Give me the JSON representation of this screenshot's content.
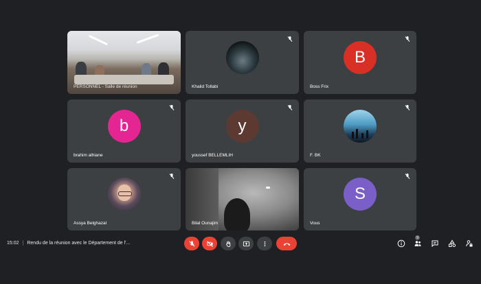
{
  "participants": [
    {
      "name": "PERSONNEL - Salle de réunion",
      "type": "room-video"
    },
    {
      "name": "Khalid Tollabi",
      "type": "photo-night"
    },
    {
      "name": "Boss Frix",
      "type": "avatar",
      "initial": "B",
      "color": "#d93025"
    },
    {
      "name": "brahim alhiane",
      "type": "avatar",
      "initial": "b",
      "color": "#e52592"
    },
    {
      "name": "youssef BELLEMLIH",
      "type": "avatar",
      "initial": "y",
      "color": "#5c3a31"
    },
    {
      "name": "F. BK",
      "type": "photo-sky"
    },
    {
      "name": "Assya Belghazal",
      "type": "photo-hijab"
    },
    {
      "name": "Bilal Ounajim",
      "type": "camera-video"
    },
    {
      "name": "Vous",
      "type": "avatar",
      "initial": "S",
      "color": "#7b5fc9"
    }
  ],
  "meeting": {
    "time": "15:02",
    "separator": "|",
    "title": "Rendu de la réunion avec le Département de l'..."
  },
  "controls": [
    {
      "name": "mic-off",
      "style": "red"
    },
    {
      "name": "camera-off",
      "style": "red"
    },
    {
      "name": "raise-hand",
      "style": "grey"
    },
    {
      "name": "present-screen",
      "style": "grey"
    },
    {
      "name": "more-options",
      "style": "grey"
    },
    {
      "name": "leave-call",
      "style": "red"
    }
  ],
  "right_panel": {
    "people_count": "9"
  }
}
